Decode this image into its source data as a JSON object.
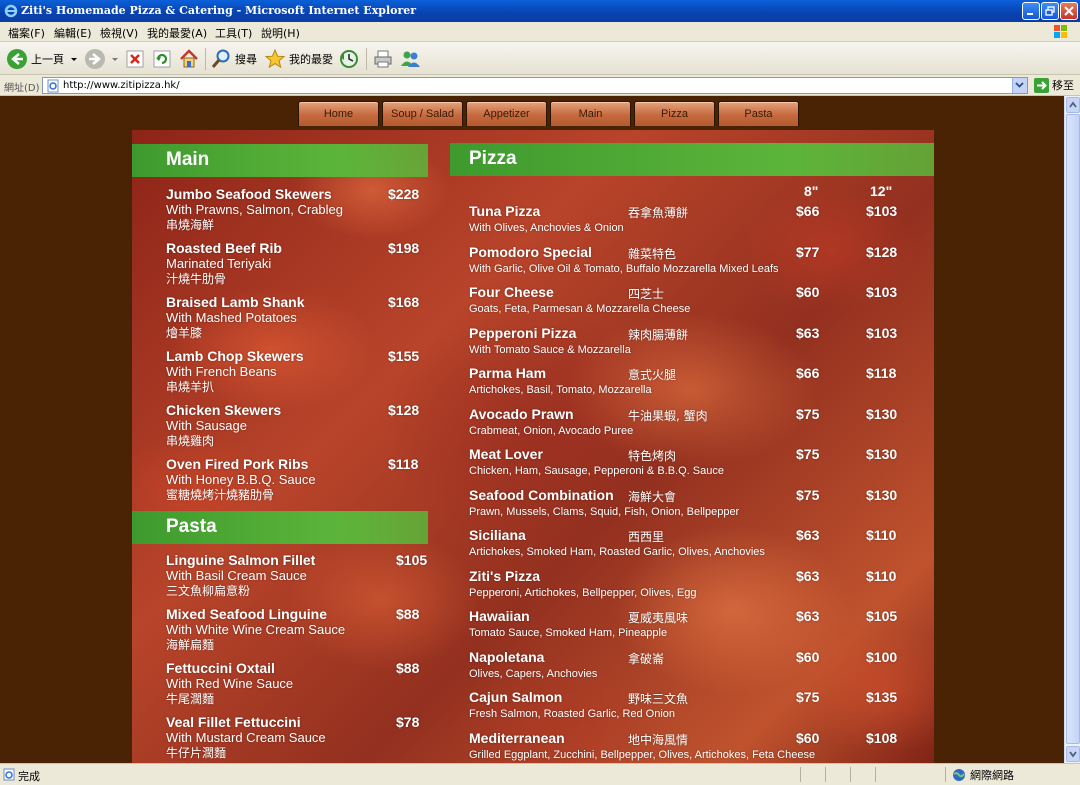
{
  "window": {
    "title": "Ziti's Homemade Pizza & Catering - Microsoft Internet Explorer"
  },
  "menubar": {
    "items": [
      "檔案(F)",
      "編輯(E)",
      "檢視(V)",
      "我的最愛(A)",
      "工具(T)",
      "說明(H)"
    ]
  },
  "toolbar": {
    "back_label": "上一頁",
    "search_label": "搜尋",
    "favorites_label": "我的最愛"
  },
  "addressbar": {
    "label": "網址(D)",
    "url": "http://www.zitipizza.hk/",
    "go_label": "移至"
  },
  "statusbar": {
    "text": "完成",
    "zone": "網際網路"
  },
  "site": {
    "nav": [
      "Home",
      "Soup / Salad",
      "Appetizer",
      "Main",
      "Pizza",
      "Pasta"
    ],
    "main": {
      "heading": "Main",
      "items": [
        {
          "name": "Jumbo Seafood Skewers",
          "price": "$228",
          "desc": "With Prawns, Salmon, Crableg",
          "cn": "串燒海鮮"
        },
        {
          "name": "Roasted Beef Rib",
          "price": "$198",
          "desc": "Marinated Teriyaki",
          "cn": "汁燒牛肋骨"
        },
        {
          "name": "Braised Lamb Shank",
          "price": "$168",
          "desc": "With Mashed Potatoes",
          "cn": "燴羊膝"
        },
        {
          "name": "Lamb Chop Skewers",
          "price": "$155",
          "desc": "With French Beans",
          "cn": "串燒羊扒"
        },
        {
          "name": "Chicken Skewers",
          "price": "$128",
          "desc": "With Sausage",
          "cn": "串燒雞肉"
        },
        {
          "name": "Oven Fired Pork Ribs",
          "price": "$118",
          "desc": "With Honey B.B.Q. Sauce",
          "cn": "蜜糖燒烤汁燒豬肋骨"
        }
      ]
    },
    "pasta": {
      "heading": "Pasta",
      "items": [
        {
          "name": "Linguine Salmon Fillet",
          "price": "$105",
          "desc": "With Basil Cream Sauce",
          "cn": "三文魚柳扁意粉"
        },
        {
          "name": "Mixed Seafood Linguine",
          "price": "$88",
          "desc": "With White Wine Cream Sauce",
          "cn": "海鮮扁麵"
        },
        {
          "name": "Fettuccini Oxtail",
          "price": "$88",
          "desc": "With Red Wine Sauce",
          "cn": "牛尾濶麵"
        },
        {
          "name": "Veal Fillet Fettuccini",
          "price": "$78",
          "desc": "With Mustard Cream Sauce",
          "cn": "牛仔片濶麵"
        }
      ]
    },
    "pizza": {
      "heading": "Pizza",
      "size_small": "8\"",
      "size_large": "12\"",
      "items": [
        {
          "name": "Tuna Pizza",
          "cn": "吞拿魚薄餅",
          "desc": "With Olives, Anchovies & Onion",
          "p8": "$66",
          "p12": "$103"
        },
        {
          "name": "Pomodoro Special",
          "cn": "雜菜特色",
          "desc": "With Garlic, Olive Oil & Tomato, Buffalo Mozzarella Mixed Leafs",
          "p8": "$77",
          "p12": "$128"
        },
        {
          "name": "Four Cheese",
          "cn": "四芝士",
          "desc": "Goats, Feta, Parmesan & Mozzarella Cheese",
          "p8": "$60",
          "p12": "$103"
        },
        {
          "name": "Pepperoni Pizza",
          "cn": "辣肉腸薄餅",
          "desc": "With Tomato Sauce & Mozzarella",
          "p8": "$63",
          "p12": "$103"
        },
        {
          "name": "Parma Ham",
          "cn": "意式火腿",
          "desc": "Artichokes, Basil, Tomato, Mozzarella",
          "p8": "$66",
          "p12": "$118"
        },
        {
          "name": "Avocado Prawn",
          "cn": "牛油果蝦, 蟹肉",
          "desc": "Crabmeat, Onion, Avocado Puree",
          "p8": "$75",
          "p12": "$130"
        },
        {
          "name": "Meat Lover",
          "cn": "特色烤肉",
          "desc": "Chicken, Ham, Sausage, Pepperoni & B.B.Q. Sauce",
          "p8": "$75",
          "p12": "$130"
        },
        {
          "name": "Seafood Combination",
          "cn": "海鮮大會",
          "desc": "Prawn, Mussels, Clams, Squid, Fish, Onion, Bellpepper",
          "p8": "$75",
          "p12": "$130"
        },
        {
          "name": "Siciliana",
          "cn": "西西里",
          "desc": "Artichokes, Smoked Ham, Roasted Garlic, Olives, Anchovies",
          "p8": "$63",
          "p12": "$110"
        },
        {
          "name": "Ziti's Pizza",
          "cn": "",
          "desc": "Pepperoni, Artichokes, Bellpepper, Olives, Egg",
          "p8": "$63",
          "p12": "$110"
        },
        {
          "name": "Hawaiian",
          "cn": "夏威夷風味",
          "desc": "Tomato Sauce, Smoked Ham, Pineapple",
          "p8": "$63",
          "p12": "$105"
        },
        {
          "name": "Napoletana",
          "cn": "拿破崙",
          "desc": "Olives, Capers, Anchovies",
          "p8": "$60",
          "p12": "$100"
        },
        {
          "name": "Cajun Salmon",
          "cn": "野味三文魚",
          "desc": "Fresh Salmon, Roasted Garlic, Red Onion",
          "p8": "$75",
          "p12": "$135"
        },
        {
          "name": "Mediterranean",
          "cn": "地中海風情",
          "desc": "Grilled Eggplant, Zucchini, Bellpepper, Olives, Artichokes, Feta Cheese",
          "p8": "$60",
          "p12": "$108"
        }
      ]
    }
  }
}
